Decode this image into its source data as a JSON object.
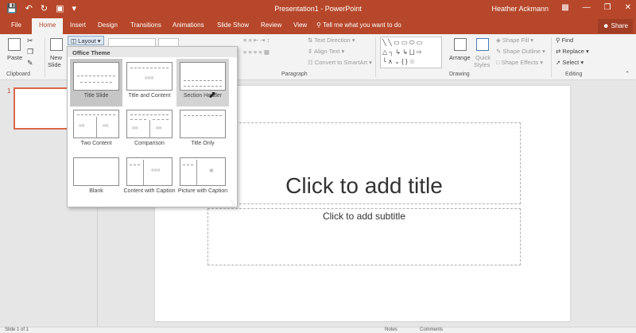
{
  "window": {
    "title": "Presentation1 - PowerPoint",
    "user": "Heather Ackmann",
    "qat_icons": [
      "save-icon",
      "undo-icon",
      "redo-icon",
      "start-from-beginning-icon",
      "customize-qat-icon"
    ],
    "controls": [
      "ribbon-display-icon",
      "minimize-icon",
      "restore-icon",
      "close-icon"
    ]
  },
  "tabs": [
    "File",
    "Home",
    "Insert",
    "Design",
    "Transitions",
    "Animations",
    "Slide Show",
    "Review",
    "View"
  ],
  "active_tab": "Home",
  "tell_me": "Tell me what you want to do",
  "share": "Share",
  "ribbon": {
    "clipboard": {
      "paste": "Paste",
      "label": "Clipboard"
    },
    "slides": {
      "new_slide_1": "New",
      "new_slide_2": "Slide",
      "layout": "Layout"
    },
    "paragraph": {
      "label": "Paragraph",
      "text_direction": "Text Direction",
      "align_text": "Align Text",
      "convert_smartart": "Convert to SmartArt"
    },
    "drawing": {
      "label": "Drawing",
      "shapes_glyphs": [
        "╲ ╲ ▭ ▭ ⬭ ▭",
        "△ ┐ ↳ ↳ ⨆ ⇨",
        "╰ ∧ ⌄ { } ☆"
      ],
      "arrange": "Arrange",
      "quick_styles_1": "Quick",
      "quick_styles_2": "Styles",
      "shape_fill": "Shape Fill",
      "shape_outline": "Shape Outline",
      "shape_effects": "Shape Effects"
    },
    "editing": {
      "label": "Editing",
      "find": "Find",
      "replace": "Replace",
      "select": "Select"
    }
  },
  "layout_gallery": {
    "header": "Office Theme",
    "items": [
      {
        "caption": "Title Slide",
        "selected": true
      },
      {
        "caption": "Title and Content"
      },
      {
        "caption": "Section Header",
        "hovered": true
      },
      {
        "caption": "Two Content"
      },
      {
        "caption": "Comparison"
      },
      {
        "caption": "Title Only"
      },
      {
        "caption": "Blank"
      },
      {
        "caption": "Content with Caption"
      },
      {
        "caption": "Picture with Caption"
      }
    ]
  },
  "thumbnails": {
    "slide_number": "1"
  },
  "slide": {
    "title_placeholder": "Click to add title",
    "subtitle_placeholder": "Click to add subtitle"
  },
  "status": {
    "slide_info": "Slide 1 of 1",
    "notes": "Notes",
    "comments": "Comments"
  },
  "colors": {
    "accent": "#b7472a",
    "ribbon": "#f3f3f3",
    "workspace": "#e6e6e6"
  }
}
